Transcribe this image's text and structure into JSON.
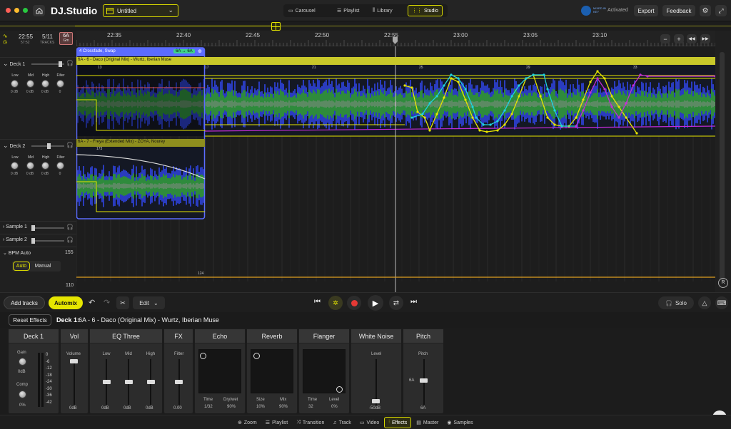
{
  "titlebar": {
    "logo": "DJ.Studio",
    "project_name": "Untitled",
    "tabs": [
      {
        "label": "Carousel"
      },
      {
        "label": "Playlist"
      },
      {
        "label": "Library"
      },
      {
        "label": "Studio"
      }
    ],
    "activated": "Activated",
    "export_label": "Export",
    "feedback_label": "Feedback",
    "mixed_in_key": "MIXED IN KEY"
  },
  "ruler": {
    "times": [
      "22:35",
      "22:40",
      "22:45",
      "22:50",
      "22:55",
      "23:00",
      "23:05",
      "23:10"
    ]
  },
  "left": {
    "time": "22:55",
    "time_sub": "57:52",
    "tracks": "5/11",
    "tracks_sub": "TRACKS",
    "key": "6A",
    "key_sub": "Gm",
    "deck1": {
      "label": "Deck 1",
      "eq": [
        "Low",
        "Mid",
        "High",
        "Filter"
      ],
      "vals": [
        "0 dB",
        "0 dB",
        "0 dB",
        "0"
      ]
    },
    "deck2": {
      "label": "Deck 2",
      "eq": [
        "Low",
        "Mid",
        "High",
        "Filter"
      ],
      "vals": [
        "0 dB",
        "0 dB",
        "0 dB",
        "0"
      ]
    },
    "sample1": "Sample 1",
    "sample2": "Sample 2",
    "bpm_auto": "BPM Auto",
    "bpm_top": "155",
    "bpm_bottom": "110",
    "auto": "Auto",
    "manual": "Manual"
  },
  "arrange": {
    "transition_label": "4 Crossfade, Swap",
    "transition_key": "6A → 6A",
    "track1": "6A - 6 - Daco (Original Mix) - Wurtz, Iberian Muse",
    "track2": "6A - 7 - Freya (Extended Mix) - ZOYA, Nourey",
    "bars_top": [
      "13",
      "17",
      "21",
      "25",
      "29",
      "33"
    ],
    "bar_t2": "173",
    "bpm_mark": "124"
  },
  "transport": {
    "add_tracks": "Add tracks",
    "automix": "Automix",
    "edit": "Edit",
    "solo": "Solo"
  },
  "fx_header": {
    "reset": "Reset Effects",
    "deck_title": "Deck 1:",
    "track": "6A - 6 - Daco (Original Mix) - Wurtz, Iberian Muse"
  },
  "fx": {
    "deck1": {
      "title": "Deck 1",
      "gain": "Gain",
      "gain_val": "0dB",
      "comp": "Comp",
      "comp_val": "0%",
      "meter": [
        "0",
        "-6",
        "-12",
        "-18",
        "-24",
        "-30",
        "-36",
        "-42"
      ]
    },
    "vol": {
      "title": "Vol",
      "label": "Volume",
      "val": "0dB"
    },
    "eq": {
      "title": "EQ Three",
      "labels": [
        "Low",
        "Mid",
        "High"
      ],
      "vals": [
        "0dB",
        "0dB",
        "0dB"
      ]
    },
    "fx": {
      "title": "FX",
      "label": "Filter",
      "val": "0.00"
    },
    "echo": {
      "title": "Echo",
      "labels": [
        "Time",
        "Dry/wet"
      ],
      "vals": [
        "1/32",
        "90%"
      ]
    },
    "reverb": {
      "title": "Reverb",
      "labels": [
        "Size",
        "Mix"
      ],
      "vals": [
        "10%",
        "90%"
      ]
    },
    "flanger": {
      "title": "Flanger",
      "labels": [
        "Time",
        "Level"
      ],
      "vals": [
        "32",
        "0%"
      ]
    },
    "noise": {
      "title": "White Noise",
      "label": "Level",
      "val": "-50dB"
    },
    "pitch": {
      "title": "Pitch",
      "label": "Pitch",
      "key": "6A",
      "val": "6A"
    }
  },
  "bottom_tabs": [
    {
      "label": "Zoom",
      "icon": "zoom-icon"
    },
    {
      "label": "Playlist",
      "icon": "playlist-icon"
    },
    {
      "label": "Transition",
      "icon": "transition-icon"
    },
    {
      "label": "Track",
      "icon": "track-icon"
    },
    {
      "label": "Video",
      "icon": "video-icon"
    },
    {
      "label": "Effects",
      "icon": "effects-icon"
    },
    {
      "label": "Master",
      "icon": "master-icon"
    },
    {
      "label": "Samples",
      "icon": "samples-icon"
    }
  ],
  "colors": {
    "accent": "#e6e600",
    "transition": "#5b6cff",
    "track1": "#c8c82a",
    "track2": "#8e8e1e",
    "cyan": "#1fd3e0",
    "magenta": "#c22cd6",
    "orange": "#e0a020"
  }
}
